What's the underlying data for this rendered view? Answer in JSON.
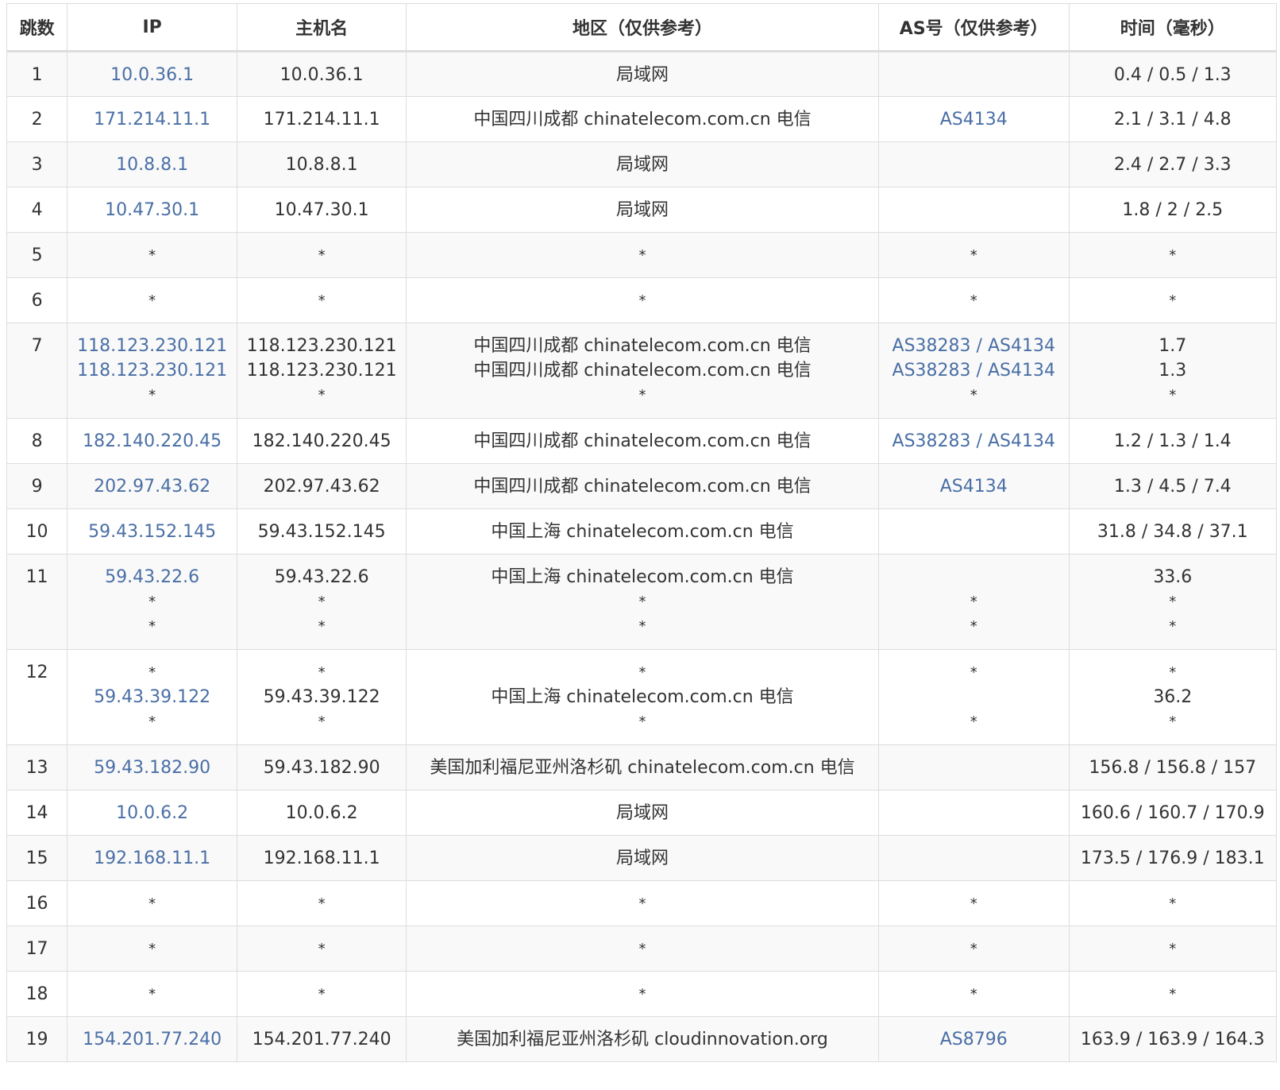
{
  "columns": {
    "hop": "跳数",
    "ip": "IP",
    "host": "主机名",
    "region": "地区（仅供参考）",
    "as": "AS号（仅供参考）",
    "time": "时间（毫秒）"
  },
  "rows": [
    {
      "hop": "1",
      "ip": [
        "10.0.36.1"
      ],
      "host": [
        "10.0.36.1"
      ],
      "region": [
        "局域网"
      ],
      "as": [],
      "time": [
        "0.4 / 0.5 / 1.3"
      ]
    },
    {
      "hop": "2",
      "ip": [
        "171.214.11.1"
      ],
      "host": [
        "171.214.11.1"
      ],
      "region": [
        "中国四川成都 chinatelecom.com.cn 电信"
      ],
      "as": [
        [
          "AS4134"
        ]
      ],
      "time": [
        "2.1 / 3.1 / 4.8"
      ]
    },
    {
      "hop": "3",
      "ip": [
        "10.8.8.1"
      ],
      "host": [
        "10.8.8.1"
      ],
      "region": [
        "局域网"
      ],
      "as": [],
      "time": [
        "2.4 / 2.7 / 3.3"
      ]
    },
    {
      "hop": "4",
      "ip": [
        "10.47.30.1"
      ],
      "host": [
        "10.47.30.1"
      ],
      "region": [
        "局域网"
      ],
      "as": [],
      "time": [
        "1.8 / 2 / 2.5"
      ]
    },
    {
      "hop": "5",
      "ip": [
        "*"
      ],
      "host": [
        "*"
      ],
      "region": [
        "*"
      ],
      "as": [
        "*"
      ],
      "time": [
        "*"
      ]
    },
    {
      "hop": "6",
      "ip": [
        "*"
      ],
      "host": [
        "*"
      ],
      "region": [
        "*"
      ],
      "as": [
        "*"
      ],
      "time": [
        "*"
      ]
    },
    {
      "hop": "7",
      "ip": [
        "118.123.230.121",
        "118.123.230.121",
        "*"
      ],
      "host": [
        "118.123.230.121",
        "118.123.230.121",
        "*"
      ],
      "region": [
        "中国四川成都 chinatelecom.com.cn 电信",
        "中国四川成都 chinatelecom.com.cn 电信",
        "*"
      ],
      "as": [
        [
          "AS38283",
          "AS4134"
        ],
        [
          "AS38283",
          "AS4134"
        ],
        "*"
      ],
      "time": [
        "1.7",
        "1.3",
        "*"
      ]
    },
    {
      "hop": "8",
      "ip": [
        "182.140.220.45"
      ],
      "host": [
        "182.140.220.45"
      ],
      "region": [
        "中国四川成都 chinatelecom.com.cn 电信"
      ],
      "as": [
        [
          "AS38283",
          "AS4134"
        ]
      ],
      "time": [
        "1.2 / 1.3 / 1.4"
      ]
    },
    {
      "hop": "9",
      "ip": [
        "202.97.43.62"
      ],
      "host": [
        "202.97.43.62"
      ],
      "region": [
        "中国四川成都 chinatelecom.com.cn 电信"
      ],
      "as": [
        [
          "AS4134"
        ]
      ],
      "time": [
        "1.3 / 4.5 / 7.4"
      ]
    },
    {
      "hop": "10",
      "ip": [
        "59.43.152.145"
      ],
      "host": [
        "59.43.152.145"
      ],
      "region": [
        "中国上海 chinatelecom.com.cn 电信"
      ],
      "as": [],
      "time": [
        "31.8 / 34.8 / 37.1"
      ]
    },
    {
      "hop": "11",
      "ip": [
        "59.43.22.6",
        "*",
        "*"
      ],
      "host": [
        "59.43.22.6",
        "*",
        "*"
      ],
      "region": [
        "中国上海 chinatelecom.com.cn 电信",
        "*",
        "*"
      ],
      "as": [
        "",
        "*",
        "*"
      ],
      "time": [
        "33.6",
        "*",
        "*"
      ]
    },
    {
      "hop": "12",
      "ip": [
        "*",
        "59.43.39.122",
        "*"
      ],
      "host": [
        "*",
        "59.43.39.122",
        "*"
      ],
      "region": [
        "*",
        "中国上海 chinatelecom.com.cn 电信",
        "*"
      ],
      "as": [
        "*",
        "",
        "*"
      ],
      "time": [
        "*",
        "36.2",
        "*"
      ]
    },
    {
      "hop": "13",
      "ip": [
        "59.43.182.90"
      ],
      "host": [
        "59.43.182.90"
      ],
      "region": [
        "美国加利福尼亚州洛杉矶 chinatelecom.com.cn 电信"
      ],
      "as": [],
      "time": [
        "156.8 / 156.8 / 157"
      ]
    },
    {
      "hop": "14",
      "ip": [
        "10.0.6.2"
      ],
      "host": [
        "10.0.6.2"
      ],
      "region": [
        "局域网"
      ],
      "as": [],
      "time": [
        "160.6 / 160.7 / 170.9"
      ]
    },
    {
      "hop": "15",
      "ip": [
        "192.168.11.1"
      ],
      "host": [
        "192.168.11.1"
      ],
      "region": [
        "局域网"
      ],
      "as": [],
      "time": [
        "173.5 / 176.9 / 183.1"
      ]
    },
    {
      "hop": "16",
      "ip": [
        "*"
      ],
      "host": [
        "*"
      ],
      "region": [
        "*"
      ],
      "as": [
        "*"
      ],
      "time": [
        "*"
      ]
    },
    {
      "hop": "17",
      "ip": [
        "*"
      ],
      "host": [
        "*"
      ],
      "region": [
        "*"
      ],
      "as": [
        "*"
      ],
      "time": [
        "*"
      ]
    },
    {
      "hop": "18",
      "ip": [
        "*"
      ],
      "host": [
        "*"
      ],
      "region": [
        "*"
      ],
      "as": [
        "*"
      ],
      "time": [
        "*"
      ]
    },
    {
      "hop": "19",
      "ip": [
        "154.201.77.240"
      ],
      "host": [
        "154.201.77.240"
      ],
      "region": [
        "美国加利福尼亚州洛杉矶 cloudinnovation.org"
      ],
      "as": [
        [
          "AS8796"
        ]
      ],
      "time": [
        "163.9 / 163.9 / 164.3"
      ]
    }
  ]
}
